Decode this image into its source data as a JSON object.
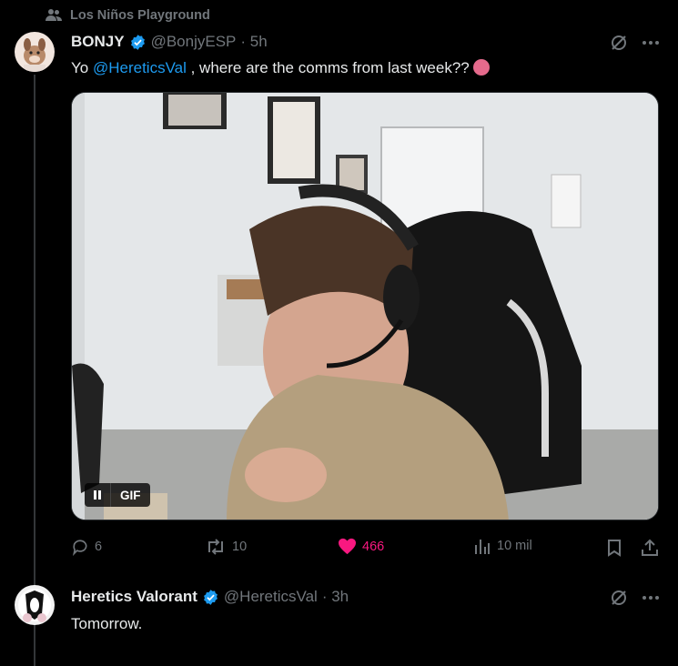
{
  "social_context": {
    "label": "Los Niños Playground",
    "icon": "people-icon"
  },
  "tweet": {
    "display_name": "BONJY",
    "handle": "@BonjyESP",
    "time": "· 5h",
    "text_before": "Yo ",
    "mention": "@HereticsVal",
    "text_after": " , where are the comms from last week??",
    "media": {
      "type": "GIF",
      "badge": "GIF"
    },
    "actions": {
      "replies": "6",
      "reposts": "10",
      "likes": "466",
      "views": "10 mil"
    },
    "colors": {
      "like": "#f91880",
      "verified": "#1d9bf0",
      "mention": "#1d9bf0"
    }
  },
  "reply": {
    "display_name": "Heretics Valorant",
    "handle": "@HereticsVal",
    "time": "· 3h",
    "text": "Tomorrow."
  }
}
